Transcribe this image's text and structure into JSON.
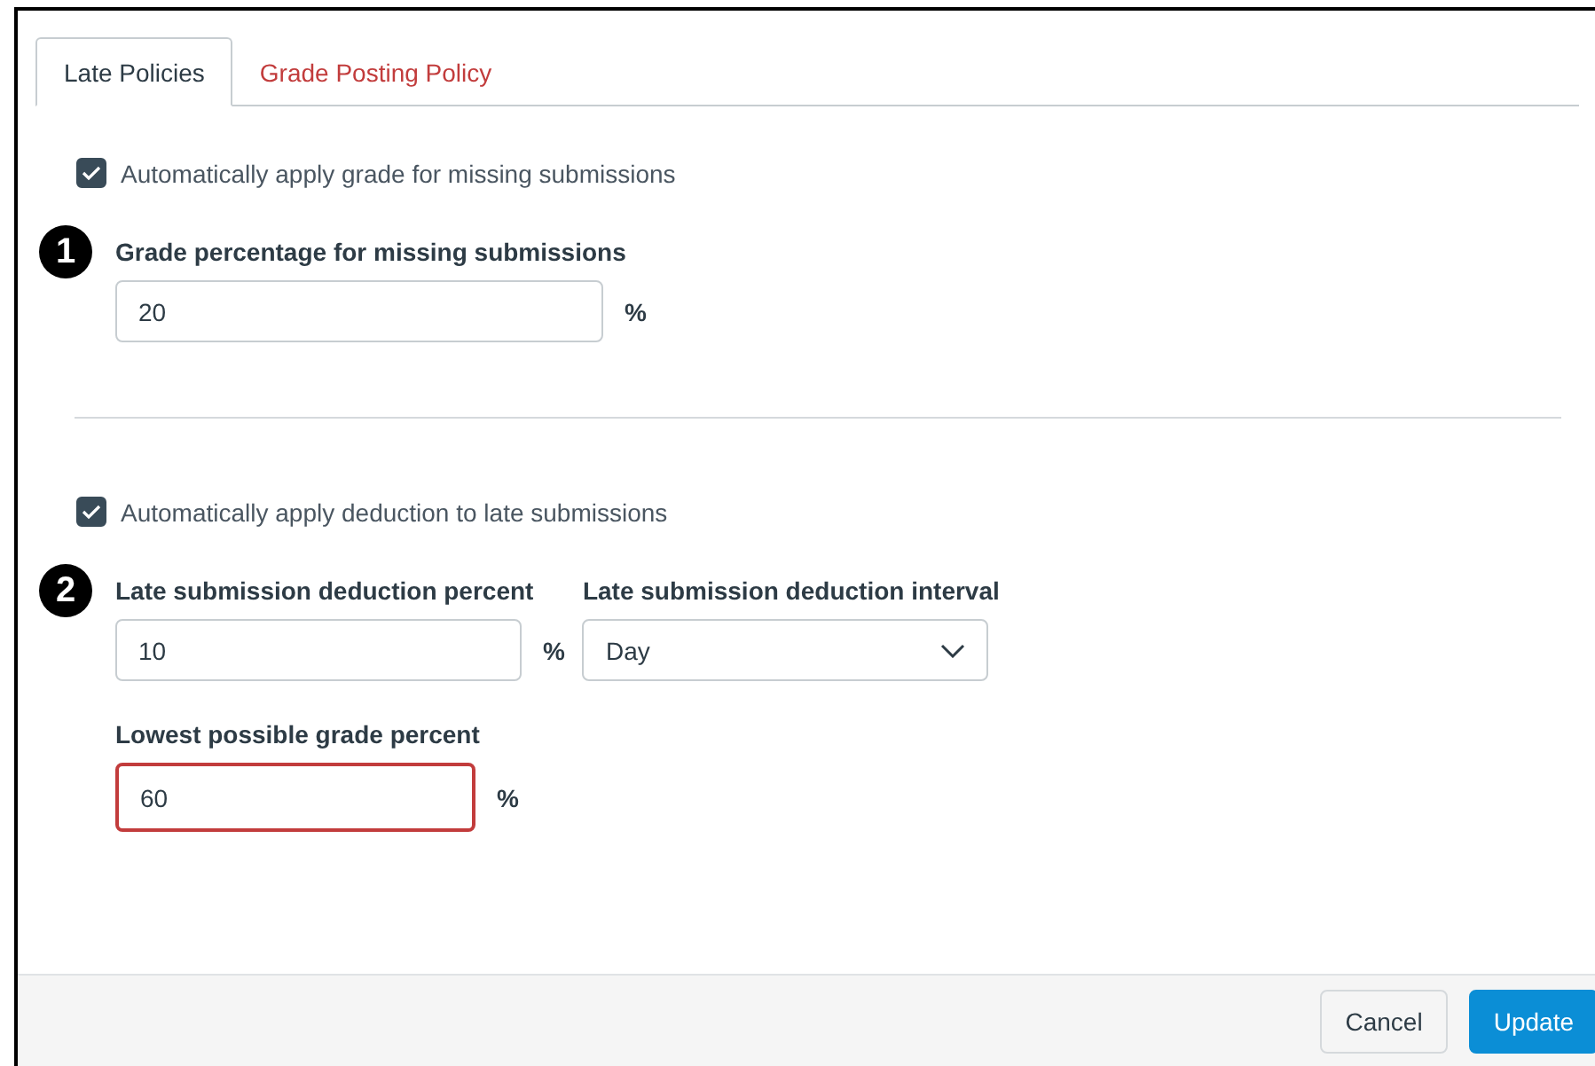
{
  "tabs": [
    {
      "label": "Late Policies",
      "selected": true
    },
    {
      "label": "Grade Posting Policy",
      "selected": false
    }
  ],
  "sections": [
    {
      "checkbox": {
        "label": "Automatically apply grade for missing submissions",
        "checked": true
      },
      "step": "1",
      "rows": [
        [
          {
            "kind": "text",
            "label": "Grade percentage for missing submissions",
            "value": "20",
            "suffix": "%",
            "focused": false
          }
        ]
      ]
    },
    {
      "checkbox": {
        "label": "Automatically apply deduction to late submissions",
        "checked": true
      },
      "step": "2",
      "rows": [
        [
          {
            "kind": "text",
            "label": "Late submission deduction percent",
            "value": "10",
            "suffix": "%",
            "focused": false
          },
          {
            "kind": "select",
            "label": "Late submission deduction interval",
            "value": "Day"
          }
        ],
        [
          {
            "kind": "text",
            "label": "Lowest possible grade percent",
            "value": "60",
            "suffix": "%",
            "focused": true
          }
        ]
      ]
    }
  ],
  "buttons": [
    {
      "label": "Cancel",
      "kind": "secondary"
    },
    {
      "label": "Update",
      "kind": "primary"
    }
  ]
}
